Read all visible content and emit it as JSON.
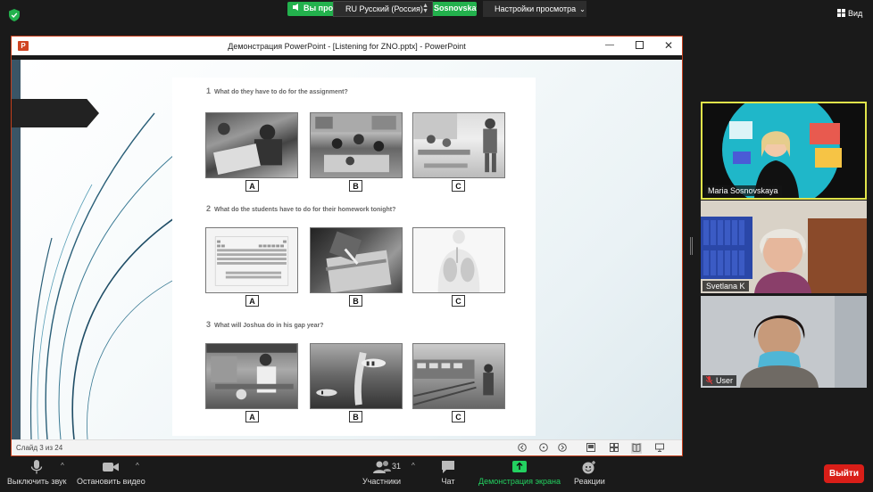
{
  "top_bar": {
    "share_left_text": "Вы просматриваете экран Maria Sosnovskaya",
    "share_right_text": "Sosnovskaya",
    "language": "RU Русский (Россия)",
    "view_settings": "Настройки просмотра",
    "view_button": "Вид"
  },
  "ppt": {
    "window_title": "Демонстрация PowerPoint - [Listening for ZNO.pptx] - PowerPoint",
    "logo_letter": "P",
    "slide_status": "Слайд 3 из 24"
  },
  "worksheet": {
    "questions": [
      {
        "num": "1",
        "text": "What do they have to do for the assignment?"
      },
      {
        "num": "2",
        "text": "What do the students have to do for their homework tonight?"
      },
      {
        "num": "3",
        "text": "What will Joshua do in his gap year?"
      }
    ],
    "options": [
      "A",
      "B",
      "C"
    ]
  },
  "participants": [
    {
      "name": "Maria Sosnovskaya",
      "muted": false,
      "active": true
    },
    {
      "name": "Svetlana K",
      "muted": false,
      "active": false
    },
    {
      "name": "User",
      "muted": true,
      "active": false
    }
  ],
  "toolbar": {
    "mute_label": "Выключить звук",
    "video_label": "Остановить видео",
    "participants_label": "Участники",
    "participants_count": "31",
    "chat_label": "Чат",
    "share_label": "Демонстрация экрана",
    "reactions_label": "Реакции",
    "exit_label": "Выйти"
  },
  "colors": {
    "zoom_green": "#23b14d",
    "active_speaker": "#e0e34a",
    "exit_red": "#d91e18",
    "ppt_orange": "#d04423"
  }
}
